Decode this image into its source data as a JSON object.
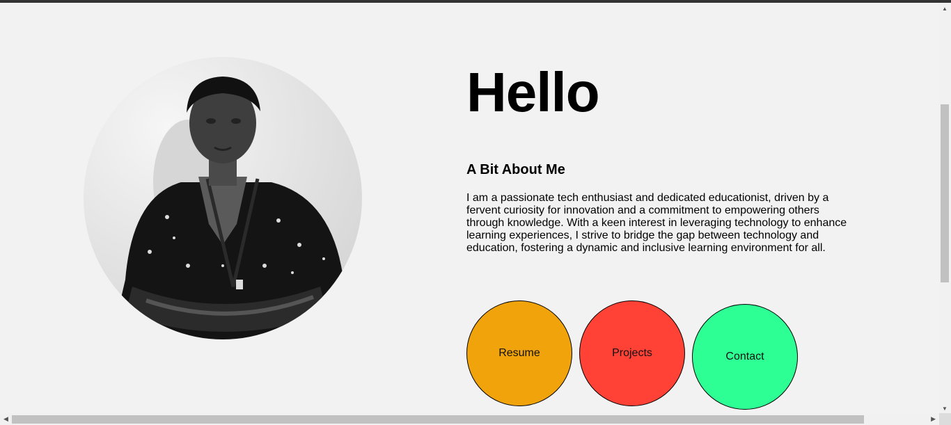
{
  "hero": {
    "greeting": "Hello",
    "about_heading": "A Bit About Me",
    "about_text": "I am a passionate tech enthusiast and dedicated educationist, driven by a fervent curiosity for innovation and a commitment to empowering others through knowledge. With a keen interest in leveraging technology to enhance learning experiences, I strive to bridge the gap between technology and education, fostering a dynamic and inclusive learning environment for all."
  },
  "buttons": [
    {
      "label": "Resume",
      "color": "#f0a30a"
    },
    {
      "label": "Projects",
      "color": "#ff4136"
    },
    {
      "label": "Contact",
      "color": "#2eff95"
    }
  ],
  "colors": {
    "background": "#f2f2f2"
  },
  "icons": {
    "portrait": "profile-photo"
  }
}
